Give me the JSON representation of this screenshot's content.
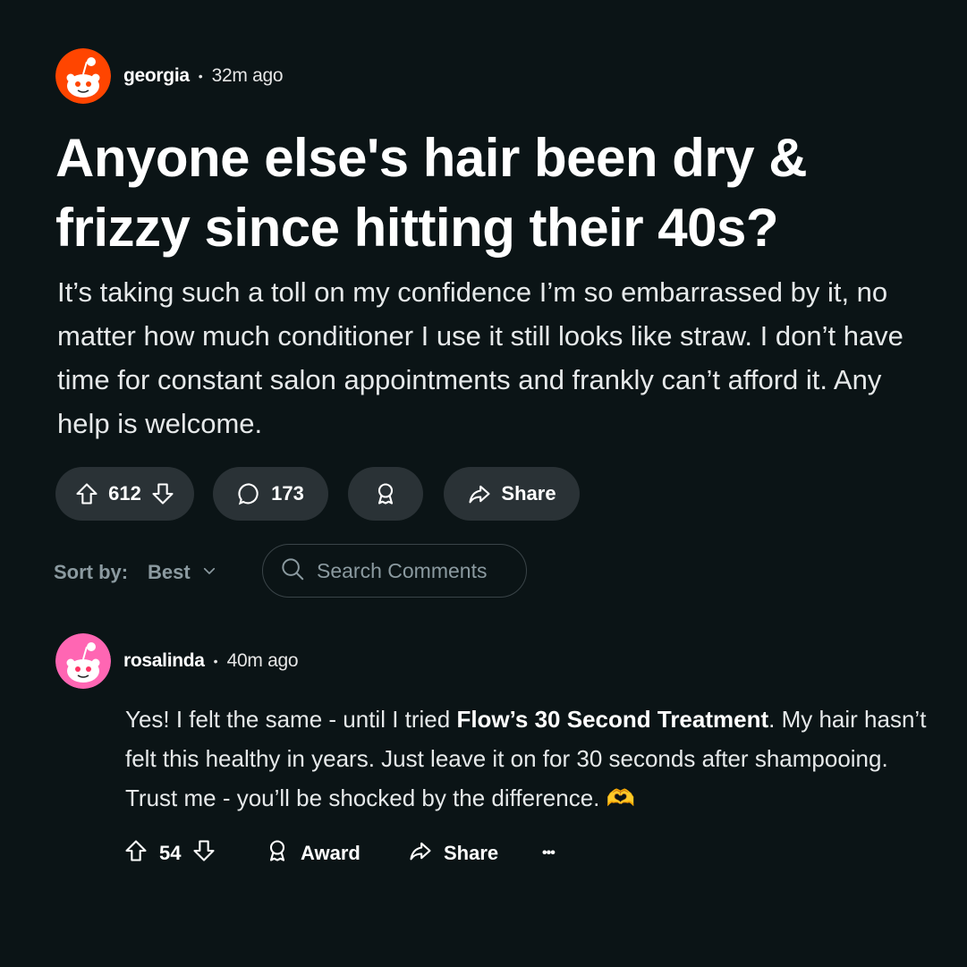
{
  "post": {
    "author": "georgia",
    "separator": "•",
    "time": "32m ago",
    "title": "Anyone else's hair been dry & frizzy since hitting their 40s?",
    "body": "It’s taking such a toll on my confidence I’m so embarrassed by it, no matter how much conditioner I use it still looks like straw. I don’t have time for constant salon appointments and frankly can’t afford it. Any help is welcome.",
    "votes": "612",
    "comments": "173",
    "share_label": "Share",
    "avatar_color": "#ff4500"
  },
  "sort": {
    "label": "Sort by:",
    "value": "Best"
  },
  "search": {
    "placeholder": "Search Comments"
  },
  "comment": {
    "author": "rosalinda",
    "separator": "•",
    "time": "40m ago",
    "text_before": "Yes! I felt the same - until I tried ",
    "text_bold": "Flow’s 30 Second Treatment",
    "text_after": ". My hair hasn’t felt this healthy in years. Just leave it on for 30 seconds after shampooing. Trust me - you’ll be shocked by the difference.",
    "emoji": "🫶",
    "votes": "54",
    "award_label": "Award",
    "share_label": "Share",
    "more_label": "•••",
    "avatar_color": "#ff66b3"
  },
  "icons": {
    "upvote": "upvote-icon",
    "downvote": "downvote-icon",
    "comment": "comment-icon",
    "award": "award-icon",
    "share": "share-icon",
    "search": "search-icon",
    "chevron": "chevron-down-icon"
  },
  "colors": {
    "background": "#0b1416",
    "pill": "#2a3236",
    "muted": "#8b9aa0"
  }
}
